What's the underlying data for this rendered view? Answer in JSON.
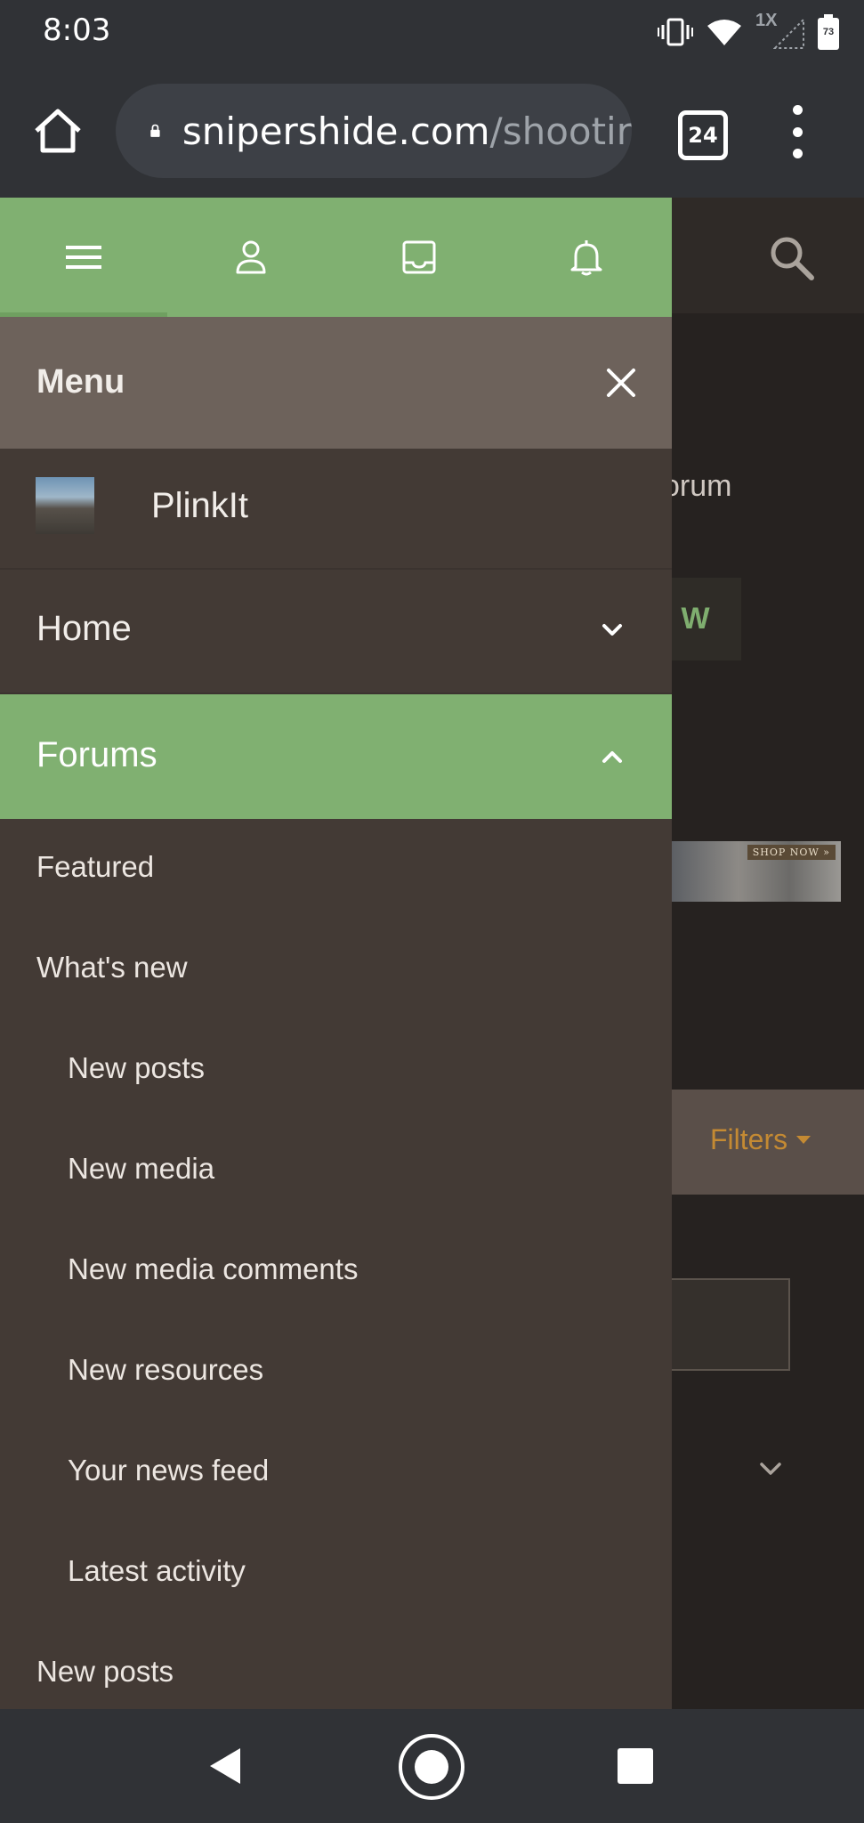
{
  "status_bar": {
    "time": "8:03",
    "network_label": "1X",
    "battery": "73"
  },
  "browser": {
    "url_host": "snipershide.com",
    "url_path": "/shootir",
    "tab_count": "24"
  },
  "background_page": {
    "forum_text": "orum",
    "button_text": "W",
    "ad_text": "SHOP NOW »",
    "filters_label": "Filters"
  },
  "drawer": {
    "tabs": [
      "menu-icon",
      "user-icon",
      "inbox-icon",
      "bell-icon"
    ],
    "menu_title": "Menu",
    "site_name": "PlinkIt",
    "nav": {
      "home_label": "Home",
      "forums_label": "Forums"
    },
    "forum_items": {
      "featured": "Featured",
      "whats_new": "What's new",
      "new_posts_sub": "New posts",
      "new_media": "New media",
      "new_media_comments": "New media comments",
      "new_resources": "New resources",
      "your_news_feed": "Your news feed",
      "latest_activity": "Latest activity",
      "new_posts": "New posts"
    }
  },
  "colors": {
    "accent_green": "#80b071",
    "drawer_bg": "#433a35",
    "menu_header_bg": "#6d625b",
    "filters_color": "#c48a33"
  }
}
